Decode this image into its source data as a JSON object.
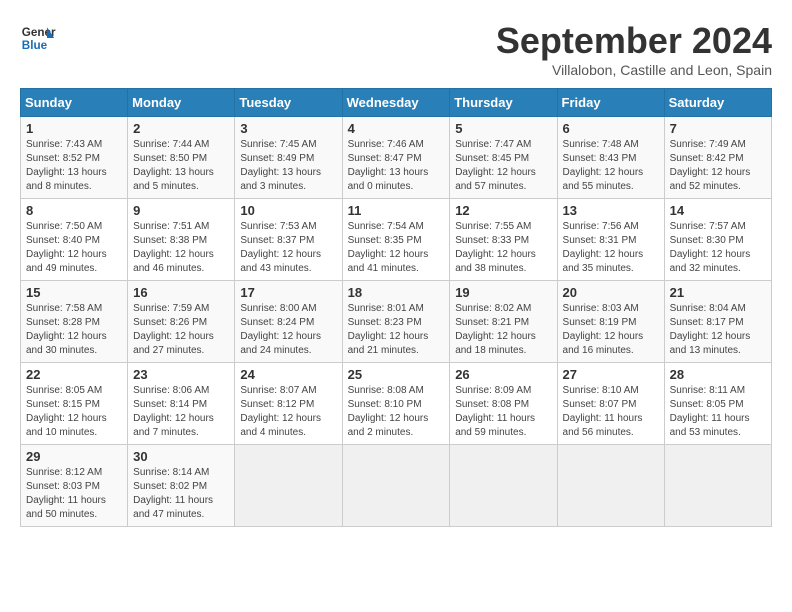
{
  "header": {
    "logo_line1": "General",
    "logo_line2": "Blue",
    "month_title": "September 2024",
    "location": "Villalobon, Castille and Leon, Spain"
  },
  "calendar": {
    "days_of_week": [
      "Sunday",
      "Monday",
      "Tuesday",
      "Wednesday",
      "Thursday",
      "Friday",
      "Saturday"
    ],
    "weeks": [
      [
        {
          "day": "1",
          "info": "Sunrise: 7:43 AM\nSunset: 8:52 PM\nDaylight: 13 hours and 8 minutes."
        },
        {
          "day": "2",
          "info": "Sunrise: 7:44 AM\nSunset: 8:50 PM\nDaylight: 13 hours and 5 minutes."
        },
        {
          "day": "3",
          "info": "Sunrise: 7:45 AM\nSunset: 8:49 PM\nDaylight: 13 hours and 3 minutes."
        },
        {
          "day": "4",
          "info": "Sunrise: 7:46 AM\nSunset: 8:47 PM\nDaylight: 13 hours and 0 minutes."
        },
        {
          "day": "5",
          "info": "Sunrise: 7:47 AM\nSunset: 8:45 PM\nDaylight: 12 hours and 57 minutes."
        },
        {
          "day": "6",
          "info": "Sunrise: 7:48 AM\nSunset: 8:43 PM\nDaylight: 12 hours and 55 minutes."
        },
        {
          "day": "7",
          "info": "Sunrise: 7:49 AM\nSunset: 8:42 PM\nDaylight: 12 hours and 52 minutes."
        }
      ],
      [
        {
          "day": "8",
          "info": "Sunrise: 7:50 AM\nSunset: 8:40 PM\nDaylight: 12 hours and 49 minutes."
        },
        {
          "day": "9",
          "info": "Sunrise: 7:51 AM\nSunset: 8:38 PM\nDaylight: 12 hours and 46 minutes."
        },
        {
          "day": "10",
          "info": "Sunrise: 7:53 AM\nSunset: 8:37 PM\nDaylight: 12 hours and 43 minutes."
        },
        {
          "day": "11",
          "info": "Sunrise: 7:54 AM\nSunset: 8:35 PM\nDaylight: 12 hours and 41 minutes."
        },
        {
          "day": "12",
          "info": "Sunrise: 7:55 AM\nSunset: 8:33 PM\nDaylight: 12 hours and 38 minutes."
        },
        {
          "day": "13",
          "info": "Sunrise: 7:56 AM\nSunset: 8:31 PM\nDaylight: 12 hours and 35 minutes."
        },
        {
          "day": "14",
          "info": "Sunrise: 7:57 AM\nSunset: 8:30 PM\nDaylight: 12 hours and 32 minutes."
        }
      ],
      [
        {
          "day": "15",
          "info": "Sunrise: 7:58 AM\nSunset: 8:28 PM\nDaylight: 12 hours and 30 minutes."
        },
        {
          "day": "16",
          "info": "Sunrise: 7:59 AM\nSunset: 8:26 PM\nDaylight: 12 hours and 27 minutes."
        },
        {
          "day": "17",
          "info": "Sunrise: 8:00 AM\nSunset: 8:24 PM\nDaylight: 12 hours and 24 minutes."
        },
        {
          "day": "18",
          "info": "Sunrise: 8:01 AM\nSunset: 8:23 PM\nDaylight: 12 hours and 21 minutes."
        },
        {
          "day": "19",
          "info": "Sunrise: 8:02 AM\nSunset: 8:21 PM\nDaylight: 12 hours and 18 minutes."
        },
        {
          "day": "20",
          "info": "Sunrise: 8:03 AM\nSunset: 8:19 PM\nDaylight: 12 hours and 16 minutes."
        },
        {
          "day": "21",
          "info": "Sunrise: 8:04 AM\nSunset: 8:17 PM\nDaylight: 12 hours and 13 minutes."
        }
      ],
      [
        {
          "day": "22",
          "info": "Sunrise: 8:05 AM\nSunset: 8:15 PM\nDaylight: 12 hours and 10 minutes."
        },
        {
          "day": "23",
          "info": "Sunrise: 8:06 AM\nSunset: 8:14 PM\nDaylight: 12 hours and 7 minutes."
        },
        {
          "day": "24",
          "info": "Sunrise: 8:07 AM\nSunset: 8:12 PM\nDaylight: 12 hours and 4 minutes."
        },
        {
          "day": "25",
          "info": "Sunrise: 8:08 AM\nSunset: 8:10 PM\nDaylight: 12 hours and 2 minutes."
        },
        {
          "day": "26",
          "info": "Sunrise: 8:09 AM\nSunset: 8:08 PM\nDaylight: 11 hours and 59 minutes."
        },
        {
          "day": "27",
          "info": "Sunrise: 8:10 AM\nSunset: 8:07 PM\nDaylight: 11 hours and 56 minutes."
        },
        {
          "day": "28",
          "info": "Sunrise: 8:11 AM\nSunset: 8:05 PM\nDaylight: 11 hours and 53 minutes."
        }
      ],
      [
        {
          "day": "29",
          "info": "Sunrise: 8:12 AM\nSunset: 8:03 PM\nDaylight: 11 hours and 50 minutes."
        },
        {
          "day": "30",
          "info": "Sunrise: 8:14 AM\nSunset: 8:02 PM\nDaylight: 11 hours and 47 minutes."
        },
        {
          "day": "",
          "info": ""
        },
        {
          "day": "",
          "info": ""
        },
        {
          "day": "",
          "info": ""
        },
        {
          "day": "",
          "info": ""
        },
        {
          "day": "",
          "info": ""
        }
      ]
    ]
  }
}
